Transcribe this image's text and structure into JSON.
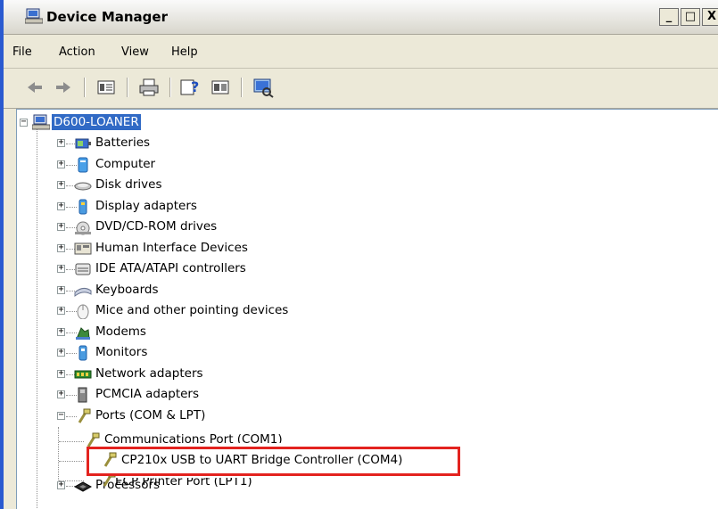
{
  "window": {
    "title": "Device Manager",
    "controls": {
      "minimize": "_",
      "maximize": "□",
      "close": "X"
    }
  },
  "menu": [
    "File",
    "Action",
    "View",
    "Help"
  ],
  "toolbar": {
    "buttons": [
      "back-icon",
      "forward-icon",
      "properties-view-icon",
      "print-icon",
      "help-icon",
      "details-view-icon",
      "scan-hardware-icon"
    ]
  },
  "tree": {
    "root": "D600-LOANER",
    "categories": [
      {
        "label": "Batteries",
        "icon": "battery-icon",
        "expanded": false
      },
      {
        "label": "Computer",
        "icon": "computer-icon",
        "expanded": false
      },
      {
        "label": "Disk drives",
        "icon": "disk-drive-icon",
        "expanded": false
      },
      {
        "label": "Display adapters",
        "icon": "display-adapter-icon",
        "expanded": false
      },
      {
        "label": "DVD/CD-ROM drives",
        "icon": "dvd-drive-icon",
        "expanded": false
      },
      {
        "label": "Human Interface Devices",
        "icon": "hid-icon",
        "expanded": false
      },
      {
        "label": "IDE ATA/ATAPI controllers",
        "icon": "ide-controller-icon",
        "expanded": false
      },
      {
        "label": "Keyboards",
        "icon": "keyboard-icon",
        "expanded": false
      },
      {
        "label": "Mice and other pointing devices",
        "icon": "mouse-icon",
        "expanded": false
      },
      {
        "label": "Modems",
        "icon": "modem-icon",
        "expanded": false
      },
      {
        "label": "Monitors",
        "icon": "monitor-icon",
        "expanded": false
      },
      {
        "label": "Network adapters",
        "icon": "network-adapter-icon",
        "expanded": false
      },
      {
        "label": "PCMCIA adapters",
        "icon": "pcmcia-icon",
        "expanded": false
      },
      {
        "label": "Ports (COM & LPT)",
        "icon": "port-icon",
        "expanded": true
      },
      {
        "label": "Processors",
        "icon": "processor-icon",
        "expanded": false
      }
    ],
    "ports_children": [
      "Communications Port (COM1)",
      "CP210x USB to UART Bridge Controller (COM4)",
      "ECP Printer Port (LPT1)"
    ]
  },
  "colors": {
    "root_selection": "#316ac5",
    "highlight_box": "#e3231f"
  }
}
